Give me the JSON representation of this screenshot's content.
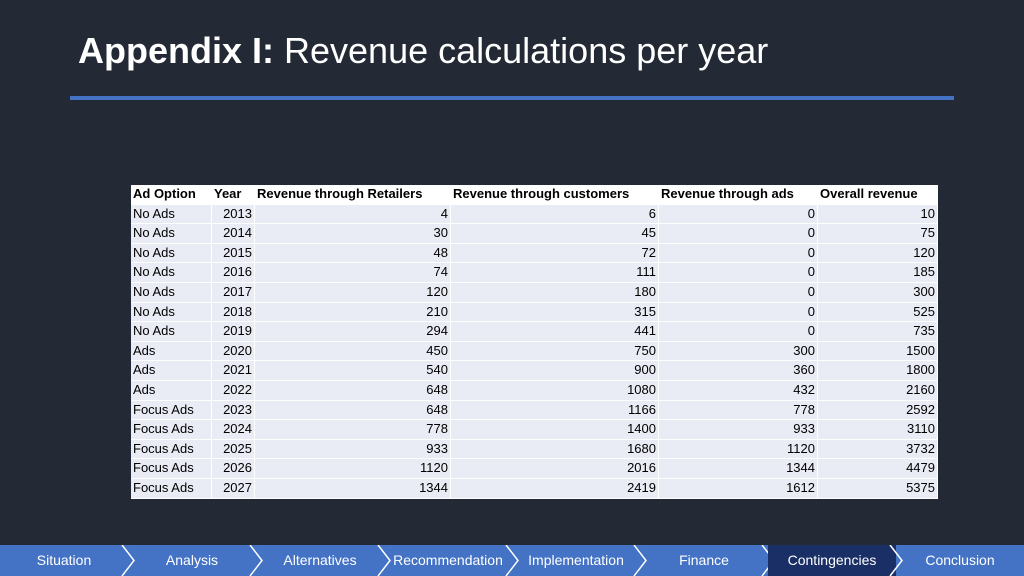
{
  "slide": {
    "title_bold": "Appendix I:",
    "title_rest": " Revenue calculations per year"
  },
  "table": {
    "headers": [
      "Ad Option",
      "Year",
      "Revenue through Retailers",
      "Revenue through customers",
      "Revenue through ads",
      "Overall revenue"
    ],
    "rows": [
      [
        "No Ads",
        "2013",
        "4",
        "6",
        "0",
        "10"
      ],
      [
        "No Ads",
        "2014",
        "30",
        "45",
        "0",
        "75"
      ],
      [
        "No Ads",
        "2015",
        "48",
        "72",
        "0",
        "120"
      ],
      [
        "No Ads",
        "2016",
        "74",
        "111",
        "0",
        "185"
      ],
      [
        "No Ads",
        "2017",
        "120",
        "180",
        "0",
        "300"
      ],
      [
        "No Ads",
        "2018",
        "210",
        "315",
        "0",
        "525"
      ],
      [
        "No Ads",
        "2019",
        "294",
        "441",
        "0",
        "735"
      ],
      [
        "Ads",
        "2020",
        "450",
        "750",
        "300",
        "1500"
      ],
      [
        "Ads",
        "2021",
        "540",
        "900",
        "360",
        "1800"
      ],
      [
        "Ads",
        "2022",
        "648",
        "1080",
        "432",
        "2160"
      ],
      [
        "Focus Ads",
        "2023",
        "648",
        "1166",
        "778",
        "2592"
      ],
      [
        "Focus Ads",
        "2024",
        "778",
        "1400",
        "933",
        "3110"
      ],
      [
        "Focus Ads",
        "2025",
        "933",
        "1680",
        "1120",
        "3732"
      ],
      [
        "Focus Ads",
        "2026",
        "1120",
        "2016",
        "1344",
        "4479"
      ],
      [
        "Focus Ads",
        "2027",
        "1344",
        "2419",
        "1612",
        "5375"
      ]
    ]
  },
  "nav": {
    "items": [
      "Situation",
      "Analysis",
      "Alternatives",
      "Recommendation",
      "Implementation",
      "Finance",
      "Contingencies",
      "Conclusion"
    ],
    "active": "Contingencies"
  },
  "colors": {
    "background": "#232a35",
    "accent": "#4472c4",
    "nav_active": "#1a2f66",
    "table_fill": "#e9ebf5"
  }
}
